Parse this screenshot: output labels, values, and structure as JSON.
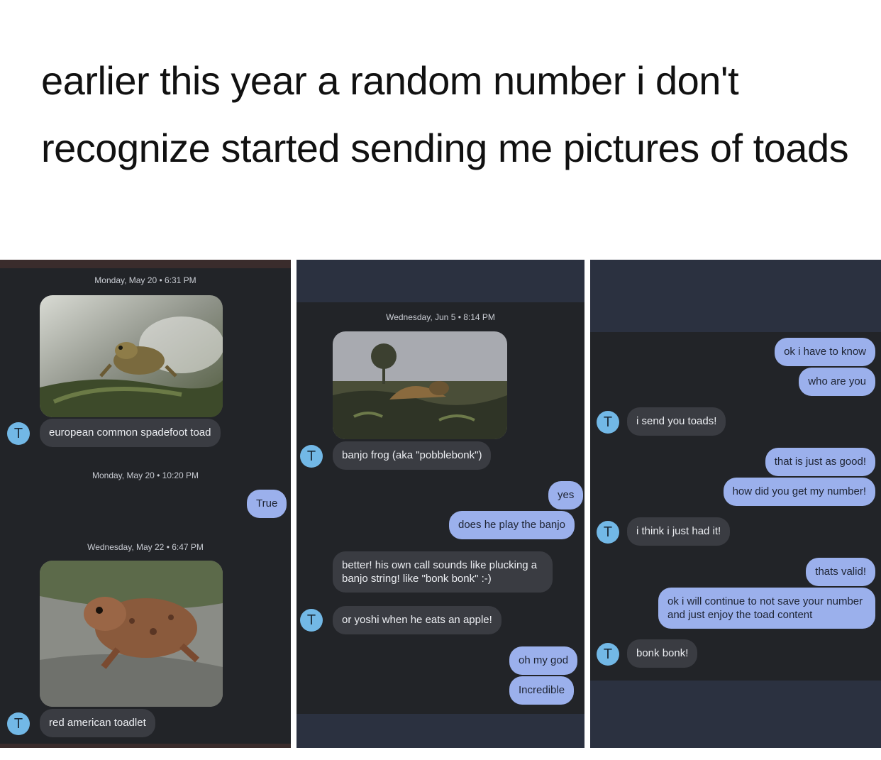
{
  "caption": "earlier this year a random number i don't recognize started sending me pictures of toads",
  "colors": {
    "panel_bg": "#222428",
    "incoming": "#3a3c42",
    "outgoing": "#9bb0ec",
    "avatar": "#72b8e6"
  },
  "contact_initial": "T",
  "panel1": {
    "stamp1": "Monday, May 20 • 6:31 PM",
    "image1": "european common spadefoot toad photo",
    "msg1": "european common spadefoot toad",
    "stamp2": "Monday, May 20 • 10:20 PM",
    "reply1": "True",
    "stamp3": "Wednesday, May 22 • 6:47 PM",
    "image2": "red american toadlet photo",
    "msg2": "red american toadlet"
  },
  "panel2": {
    "stamp1": "Wednesday, Jun 5 • 8:14 PM",
    "image1": "banjo frog photo",
    "msg1": "banjo frog (aka \"pobblebonk\")",
    "reply1": "yes",
    "reply2": "does he play the banjo",
    "msg2": "better! his own call sounds like plucking a banjo string! like \"bonk bonk\" :-)",
    "msg3": "or yoshi when he eats an apple!",
    "reply3": "oh my god",
    "reply4": "Incredible"
  },
  "panel3": {
    "out1": "ok i have to know",
    "out2": "who are you",
    "in1": "i send you toads!",
    "out3": "that is just as good!",
    "out4": "how did you get my number!",
    "in2": "i think i just had it!",
    "out5": "thats valid!",
    "out6": "ok i will continue to not save your number and just enjoy the toad content",
    "in3": "bonk bonk!"
  }
}
